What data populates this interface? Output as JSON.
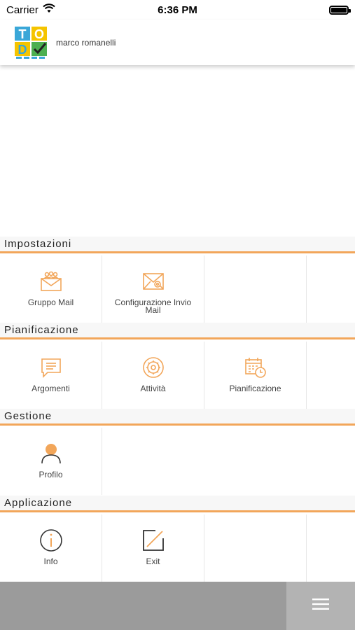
{
  "status_bar": {
    "carrier": "Carrier",
    "time": "6:36 PM"
  },
  "header": {
    "username": "marco romanelli",
    "logo_icon": "todo-list-logo"
  },
  "sections": [
    {
      "title": "Impostazioni",
      "tiles": [
        {
          "label": "Gruppo Mail",
          "icon": "group-mail-icon"
        },
        {
          "label": "Configurazione Invio Mail",
          "icon": "mail-settings-icon"
        }
      ]
    },
    {
      "title": "Pianificazione",
      "tiles": [
        {
          "label": "Argomenti",
          "icon": "chat-icon"
        },
        {
          "label": "Attività",
          "icon": "activity-gear-icon"
        },
        {
          "label": "Pianificazione",
          "icon": "calendar-clock-icon"
        }
      ]
    },
    {
      "title": "Gestione",
      "tiles": [
        {
          "label": "Profilo",
          "icon": "profile-icon"
        }
      ]
    },
    {
      "title": "Applicazione",
      "tiles": [
        {
          "label": "Info",
          "icon": "info-icon"
        },
        {
          "label": "Exit",
          "icon": "exit-icon"
        }
      ]
    }
  ],
  "bottom_bar": {
    "menu_icon": "hamburger-menu-icon"
  },
  "colors": {
    "accent": "#f2a65a",
    "tile_border": "#e6e6e6",
    "bottom_bar": "#9b9b9b",
    "menu_button": "#b3b3b3"
  }
}
